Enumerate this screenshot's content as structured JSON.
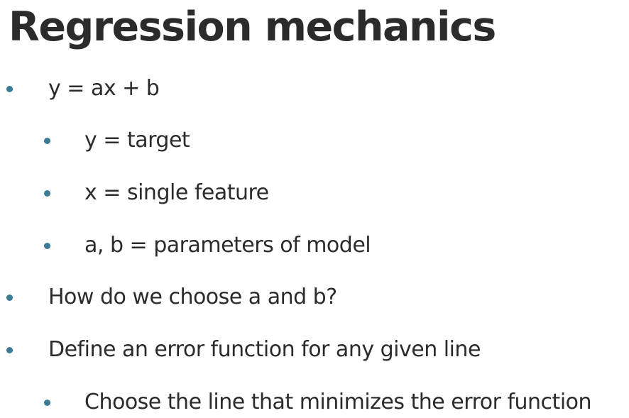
{
  "slide": {
    "title": "Regression mechanics",
    "bullets": [
      {
        "text": "y = ax + b"
      },
      {
        "text": "y = target"
      },
      {
        "text": "x = single feature"
      },
      {
        "text": "a, b = parameters of model"
      },
      {
        "text": "How do we choose a and b?"
      },
      {
        "text": " Define an error function for any given line"
      },
      {
        "text": "Choose the line that minimizes the error function"
      }
    ]
  }
}
